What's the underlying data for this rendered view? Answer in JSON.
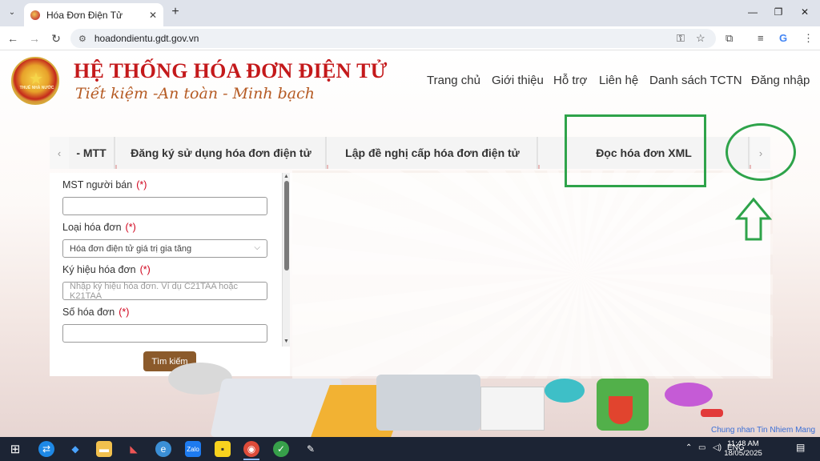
{
  "browser": {
    "tab_title": "Hóa Đơn Điện Tử",
    "url": "hoadondientu.gdt.gov.vn"
  },
  "header": {
    "brand_title": "HỆ THỐNG HÓA ĐƠN ĐIỆN TỬ",
    "brand_slogan": "Tiết kiệm -An toàn - Minh bạch",
    "logo_text": "THUẾ NHÀ NƯỚC",
    "nav": [
      "Trang chủ",
      "Giới thiệu",
      "Hỗ trợ",
      "Liên hệ",
      "Danh sách TCTN",
      "Đăng nhập"
    ]
  },
  "tabs": {
    "left_arrow": "‹",
    "right_arrow": "›",
    "items": [
      "- MTT",
      "Đăng ký sử dụng hóa đơn điện tử",
      "Lập đề nghị cấp hóa đơn điện tử",
      "Đọc hóa đơn XML"
    ]
  },
  "form": {
    "seller_tax_label": "MST người bán",
    "required_mark": "(*)",
    "invoice_type_label": "Loại hóa đơn",
    "invoice_type_value": "Hóa đơn điện tử giá trị gia tăng",
    "symbol_label": "Ký hiệu hóa đơn",
    "symbol_placeholder": "Nhập ký hiệu hóa đơn. Ví dụ C21TAA hoặc K21TAA",
    "number_label": "Số hóa đơn",
    "search_button": "Tìm kiếm"
  },
  "footer": {
    "cert_link": "Chung nhan Tin Nhiem Mang"
  },
  "taskbar": {
    "language": "ENG",
    "time": "11:48 AM",
    "date": "18/05/2025"
  },
  "colors": {
    "brand_red": "#c4191b",
    "slogan_brown": "#b55b24",
    "search_button": "#8b5a2b",
    "annotation_green": "#2ea34a",
    "required_red": "#d0021b"
  }
}
